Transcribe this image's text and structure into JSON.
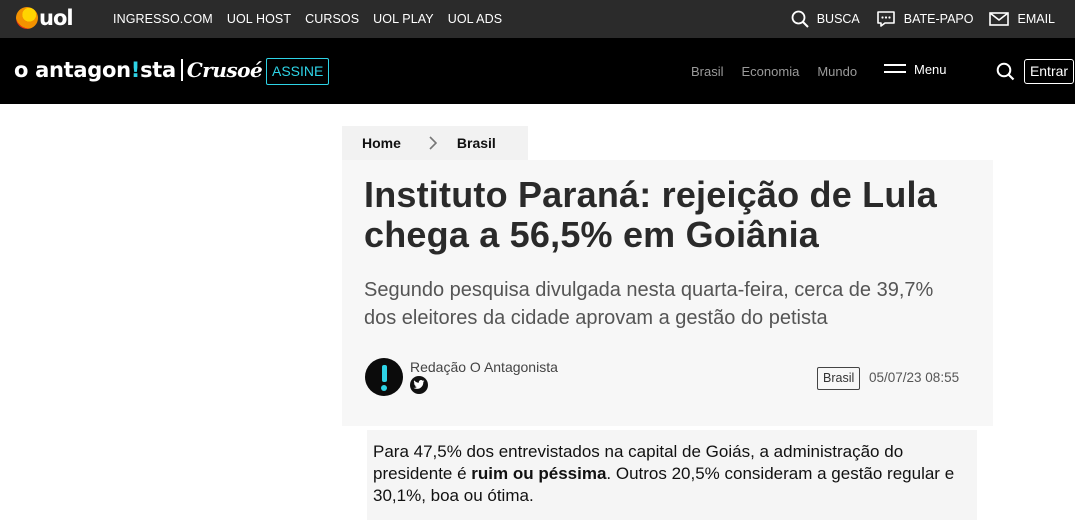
{
  "uolbar": {
    "logo_text": "uol",
    "links": [
      "INGRESSO.COM",
      "UOL HOST",
      "CURSOS",
      "UOL PLAY",
      "UOL ADS"
    ],
    "right": [
      {
        "label": "BUSCA",
        "icon": "search-icon"
      },
      {
        "label": "BATE-PAPO",
        "icon": "chat-icon"
      },
      {
        "label": "EMAIL",
        "icon": "mail-icon"
      }
    ]
  },
  "header": {
    "brand_main_pre": "o antagon",
    "brand_main_bang": "!",
    "brand_main_post": "sta",
    "brand_secondary": "Crusoé",
    "assine": "ASSINE",
    "nav": [
      "Brasil",
      "Economia",
      "Mundo"
    ],
    "menu_label": "Menu",
    "login": "Entrar",
    "accent": "#2ed3e6"
  },
  "breadcrumb": {
    "home": "Home",
    "section": "Brasil"
  },
  "article": {
    "title": "Instituto Paraná: rejeição de Lula chega a 56,5% em Goiânia",
    "subtitle": "Segundo pesquisa divulgada nesta quarta-feira, cerca de 39,7% dos eleitores da cidade aprovam a gestão do petista",
    "author": "Redação O Antagonista",
    "tag": "Brasil",
    "date": "05/07/23 08:55",
    "body_pre": "Para 47,5% dos entrevistados na capital de Goiás, a administração do presidente é ",
    "body_bold": "ruim ou péssima",
    "body_post": ". Outros 20,5% consideram a gestão regular e 30,1%, boa ou ótima."
  }
}
